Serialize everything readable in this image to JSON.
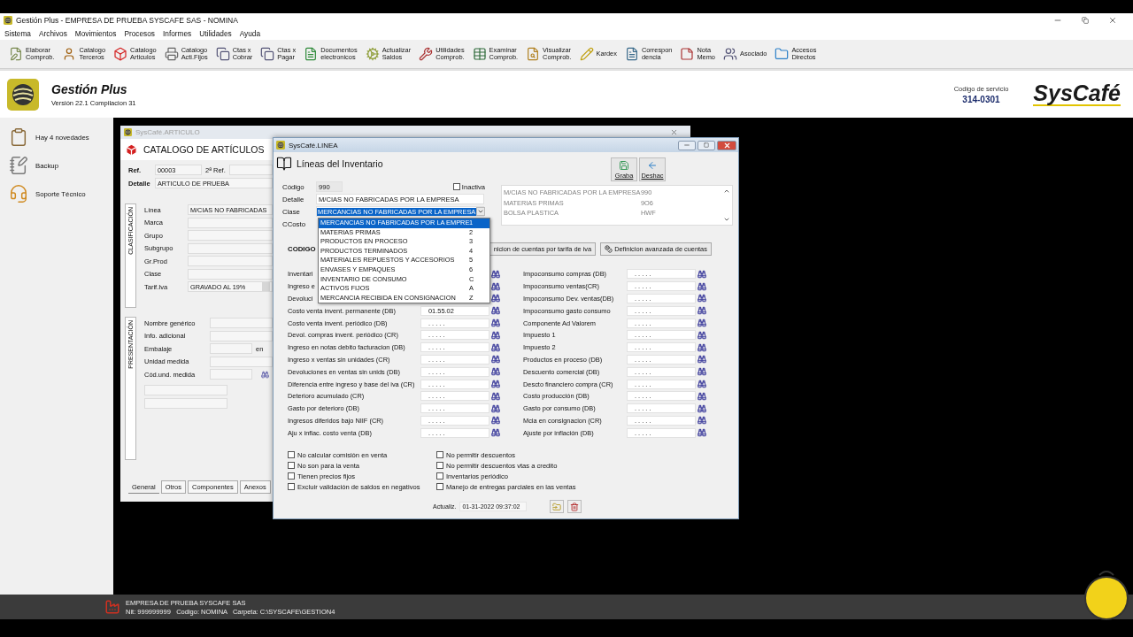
{
  "app_window": {
    "title": "Gestión Plus - EMPRESA DE PRUEBA SYSCAFE SAS - NOMINA"
  },
  "menu": [
    "Sistema",
    "Archivos",
    "Movimientos",
    "Procesos",
    "Informes",
    "Utilidades",
    "Ayuda"
  ],
  "toolbar": [
    "Elaborar\nComprob.",
    "Catalogo\nTerceros",
    "Catalogo\nArticulos",
    "Catalogo\nActi.Fijos",
    "Ctas x\nCobrar",
    "Ctas x\nPagar",
    "Documentos\nelectronicos",
    "Actualizar\nSaldos",
    "Utilidades\nComprob.",
    "Examinar\nComprob.",
    "Visualizar\nComprob.",
    "Kardex",
    "Correspon\ndencia",
    "Nota\nMemo",
    "Asociado",
    "Accesos\nDirectos"
  ],
  "header": {
    "product": "Gestión Plus",
    "version": "Versión 22.1  Compilacion 31",
    "service_label": "Codigo de servicio",
    "service_code": "314-0301",
    "brand": "SysCafé"
  },
  "sidebar": [
    "Hay 4 novedades",
    "Backup",
    "Soporte Técnico"
  ],
  "articulo": {
    "title": "SysCafé.ARTICULO",
    "heading": "CATALOGO DE ARTÍCULOS",
    "ref_label": "Ref.",
    "ref": "00003",
    "ref2_label": "2ª Ref.",
    "detail_label": "Detalle",
    "detail": "ARTICULO DE PRUEBA",
    "classification": {
      "title": "CLASIFICACIÓN",
      "rows": [
        {
          "label": "Línea",
          "value": "M/CIAS NO FABRICADAS",
          "kind": "text"
        },
        {
          "label": "Marca",
          "kind": "text"
        },
        {
          "label": "Grupo",
          "kind": "text"
        },
        {
          "label": "Subgrupo",
          "kind": "text"
        },
        {
          "label": "Gr.Prod",
          "kind": "text"
        },
        {
          "label": "Clase",
          "kind": "text"
        },
        {
          "label": "Tarif.Iva",
          "value": "GRAVADO AL 19%",
          "kind": "combo"
        }
      ]
    },
    "presentation": {
      "title": "PRESENTACIÓN",
      "rows": [
        {
          "label": "Nombre genérico",
          "kind": "wide"
        },
        {
          "label": "Info. adicional",
          "kind": "wide"
        },
        {
          "label": "Embalaje",
          "kind": "unit",
          "suffix": "en"
        },
        {
          "label": "Unidad medida",
          "kind": "wide"
        },
        {
          "label": "Cód.und. medida",
          "kind": "lookup"
        }
      ]
    },
    "tabs": [
      {
        "label": "General",
        "selected": true
      },
      {
        "label": "Otros",
        "selected": false
      },
      {
        "label": "Componentes",
        "selected": false
      },
      {
        "label": "Anexos",
        "selected": false
      }
    ]
  },
  "linea": {
    "title": "SysCafé.LINEA",
    "heading": "Líneas del Inventario",
    "actions": [
      "Graba",
      "Deshac"
    ],
    "code_label": "Código",
    "code": "990",
    "inactive": {
      "label": "Inactiva",
      "checked": false
    },
    "detail_label": "Detalle",
    "detail": "M/CIAS NO FABRICADAS POR LA EMPRESA",
    "class_label": "Clase",
    "class_value": "MERCANCIAS NO FABRICADAS POR LA EMPRESA",
    "cost_center_label": "CCosto",
    "class_options": [
      {
        "label": "MERCANCIAS NO FABRICADAS POR LA EMPRE",
        "code": "1",
        "selected": true
      },
      {
        "label": "MATERIAS PRIMAS",
        "code": "2",
        "selected": false
      },
      {
        "label": "PRODUCTOS EN PROCESO",
        "code": "3",
        "selected": false
      },
      {
        "label": "PRODUCTOS TERMINADOS",
        "code": "4",
        "selected": false
      },
      {
        "label": "MATERIALES REPUESTOS Y ACCESORIOS",
        "code": "5",
        "selected": false
      },
      {
        "label": "ENVASES Y EMPAQUES",
        "code": "6",
        "selected": false
      },
      {
        "label": "INVENTARIO DE CONSUMO",
        "code": "C",
        "selected": false
      },
      {
        "label": "ACTIVOS FIJOS",
        "code": "A",
        "selected": false
      },
      {
        "label": "MERCANCIA RECIBIDA EN CONSIGNACION",
        "code": "Z",
        "selected": false
      }
    ],
    "lookup": [
      {
        "name": "M/CIAS NO FABRICADAS POR LA EMPRESA",
        "code": "990"
      },
      {
        "name": "MATERIAS PRIMAS",
        "code": "9O6"
      },
      {
        "name": "BOLSA PLASTICA",
        "code": "HWF"
      }
    ],
    "codes_label": "CODIGO",
    "account_buttons": [
      "nicion de cuentas por tarifa de iva",
      "Definicion avanzada de cuentas"
    ],
    "accounts_left": [
      {
        "label": "Inventari"
      },
      {
        "label": "Ingreso e"
      },
      {
        "label": "Devoluci"
      },
      {
        "label": "Costo venta invent. permanente (DB)",
        "value": "01.55.02"
      },
      {
        "label": "Costo venta invent. periódico (DB)",
        "value": ". . . . ."
      },
      {
        "label": "Devol. compras invent. periódico (CR)",
        "value": ". . . . ."
      },
      {
        "label": "Ingreso en notas debito facturacion (DB)",
        "value": ". . . . ."
      },
      {
        "label": "Ingreso x ventas sin unidades (CR)",
        "value": ". . . . ."
      },
      {
        "label": "Devoluciones en ventas sin unids (DB)",
        "value": ". . . . ."
      },
      {
        "label": "Diferencia entre ingreso y base del iva (CR)",
        "value": ". . . . ."
      },
      {
        "label": "Deterioro acumulado (CR)",
        "value": ". . . . ."
      },
      {
        "label": "Gasto por deterioro (DB)",
        "value": ". . . . ."
      },
      {
        "label": "Ingresos diferidos bajo NIIF (CR)",
        "value": ". . . . ."
      },
      {
        "label": "Aju x inflac. costo venta (DB)",
        "value": ". . . . ."
      }
    ],
    "accounts_right": [
      {
        "label": "Impoconsumo compras (DB)",
        "value": ". . . . ."
      },
      {
        "label": "Impoconsumo ventas(CR)",
        "value": ". . . . ."
      },
      {
        "label": "Impoconsumo Dev. ventas(DB)",
        "value": ". . . . ."
      },
      {
        "label": "Impoconsumo gasto consumo",
        "value": ". . . . ."
      },
      {
        "label": "Componente Ad Valorem",
        "value": ". . . . ."
      },
      {
        "label": "Impuesto 1",
        "value": ". . . . ."
      },
      {
        "label": "Impuesto 2",
        "value": ". . . . ."
      },
      {
        "label": "Productos en proceso (DB)",
        "value": ". . . . ."
      },
      {
        "label": "Descuento comercial (DB)",
        "value": ". . . . ."
      },
      {
        "label": "Descto financiero compra (CR)",
        "value": ". . . . ."
      },
      {
        "label": "Costo producción (DB)",
        "value": ". . . . ."
      },
      {
        "label": "Gasto por consumo (DB)",
        "value": ". . . . ."
      },
      {
        "label": "Mcia en consignacion (CR)",
        "value": ". . . . ."
      },
      {
        "label": "Ajuste por inflación (DB)",
        "value": ". . . . ."
      }
    ],
    "options_left": [
      {
        "label": "No calcular comisión en venta",
        "checked": false
      },
      {
        "label": "No son para la venta",
        "checked": false
      },
      {
        "label": "Tienen precios fijos",
        "checked": false
      },
      {
        "label": "Excluir validación de saldos en negativos",
        "checked": false
      }
    ],
    "options_right": [
      {
        "label": "No permitir descuentos",
        "checked": false
      },
      {
        "label": "No permitir descuentos vtas a credito",
        "checked": false
      },
      {
        "label": "Inventarios periódico",
        "checked": false
      },
      {
        "label": "Manejo de entregas parciales en las ventas",
        "checked": false
      }
    ],
    "updated_label": "Actualiz.",
    "updated": "01-31-2022 09:37:02"
  },
  "status_bar": {
    "company": "EMPRESA DE PRUEBA SYSCAFE SAS",
    "details": "Nit: 999999999   Codigo: NOMINA   Carpeta: C:\\SYSCAFE\\GESTION4"
  }
}
